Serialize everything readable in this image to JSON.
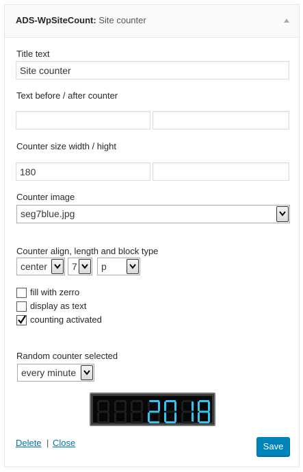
{
  "widget": {
    "title_main": "ADS-WpSiteCount:",
    "title_sub": "Site counter"
  },
  "form": {
    "title_label": "Title text",
    "title_value": "Site counter",
    "before_after_label": "Text before / after counter",
    "before_value": "",
    "after_value": "",
    "size_label": "Counter size width / hight",
    "width_value": "180",
    "height_value": "",
    "image_label": "Counter image",
    "image_selected": "seg7blue.jpg",
    "align_label": "Counter align, length and block type",
    "align_selected": "center",
    "length_selected": "7",
    "block_selected": "p",
    "checkboxes": [
      {
        "label": "fill with zerro",
        "checked": false
      },
      {
        "label": "display as text",
        "checked": false
      },
      {
        "label": "counting activated",
        "checked": true
      }
    ],
    "random_label": "Random counter selected",
    "random_selected": "every minute"
  },
  "preview": {
    "digits": [
      "8",
      "8",
      "8",
      "2",
      "0",
      "1",
      "8"
    ],
    "lit": [
      false,
      false,
      false,
      true,
      true,
      true,
      true
    ],
    "lit_color": "#2ec6f2",
    "unlit_color": "#1e1e1e"
  },
  "actions": {
    "delete_label": "Delete",
    "separator": "|",
    "close_label": "Close",
    "save_label": "Save"
  },
  "colors": {
    "link": "#0073aa",
    "primary_button": "#0085ba"
  }
}
